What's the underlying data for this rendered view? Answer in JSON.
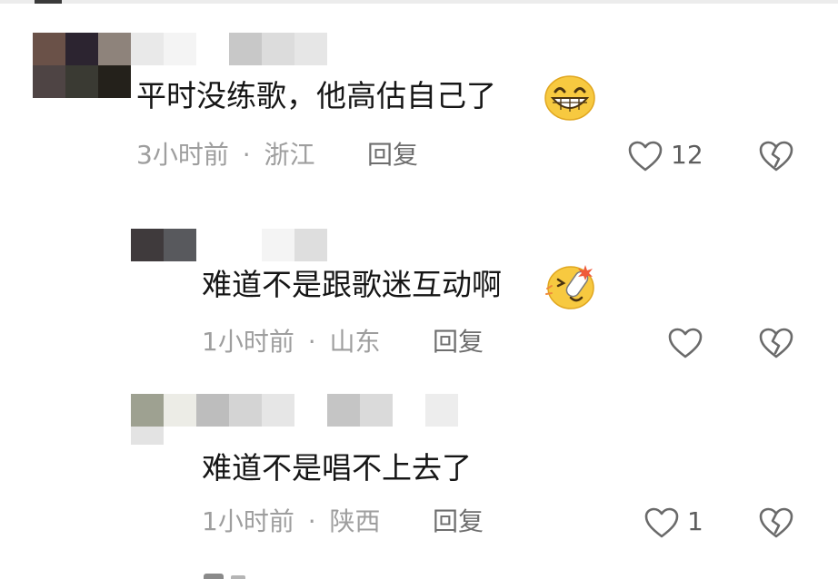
{
  "comments": [
    {
      "text": "平时没练歌，他高估自己了",
      "emoji": "grinning-face-icon",
      "time": "3小时前",
      "separator": "·",
      "location": "浙江",
      "reply_label": "回复",
      "like_count": "12"
    },
    {
      "text": "难道不是跟歌迷互动啊",
      "emoji": "cheering-face-icon",
      "time": "1小时前",
      "separator": "·",
      "location": "山东",
      "reply_label": "回复",
      "like_count": ""
    },
    {
      "text": "难道不是唱不上去了",
      "emoji": "",
      "time": "1小时前",
      "separator": "·",
      "location": "陕西",
      "reply_label": "回复",
      "like_count": "1"
    }
  ],
  "icons": {
    "like": "heart-outline-icon",
    "dislike": "broken-heart-icon"
  },
  "colors": {
    "text": "#161616",
    "meta": "#9e9e9e",
    "icon": "#6a6a6a",
    "emoji_yellow": "#f7c940"
  }
}
